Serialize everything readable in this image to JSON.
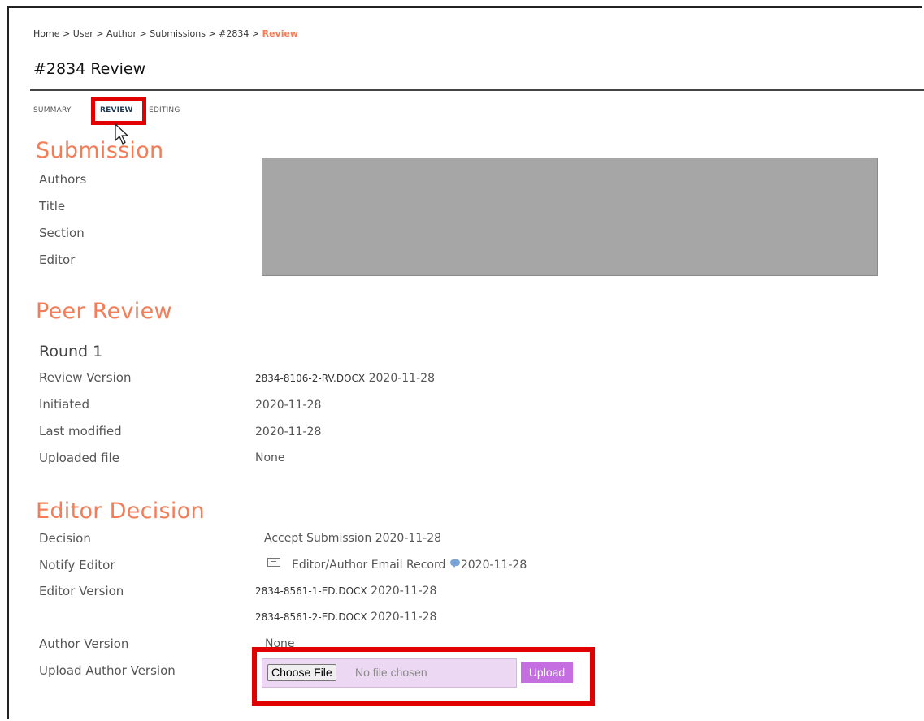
{
  "breadcrumb": {
    "items": [
      "Home",
      "User",
      "Author",
      "Submissions",
      "#2834"
    ],
    "separator": ">",
    "current": "Review"
  },
  "page": {
    "title": "#2834 Review"
  },
  "tabs": [
    {
      "label": "SUMMARY",
      "active": false
    },
    {
      "label": "REVIEW",
      "active": true
    },
    {
      "label": "EDITING",
      "active": false
    }
  ],
  "submission": {
    "heading": "Submission",
    "labels": [
      "Authors",
      "Title",
      "Section",
      "Editor"
    ]
  },
  "peer_review": {
    "heading": "Peer Review",
    "round": "Round 1",
    "rows": [
      {
        "label": "Review Version",
        "value": "2834-8106-2-RV.DOCX",
        "date": "2020-11-28"
      },
      {
        "label": "Initiated",
        "value": "2020-11-28"
      },
      {
        "label": "Last modified",
        "value": "2020-11-28"
      },
      {
        "label": "Uploaded file",
        "value": "None"
      }
    ]
  },
  "editor_decision": {
    "heading": "Editor Decision",
    "decision_label": "Decision",
    "decision_value": "Accept Submission 2020-11-28",
    "notify_label": "Notify Editor",
    "notify_link": "Editor/Author Email Record",
    "notify_date": "2020-11-28",
    "editor_version_label": "Editor Version",
    "editor_versions": [
      {
        "file": "2834-8561-1-ED.DOCX",
        "date": "2020-11-28"
      },
      {
        "file": "2834-8561-2-ED.DOCX",
        "date": "2020-11-28"
      }
    ],
    "author_version_label": "Author Version",
    "author_version_value": "None",
    "upload_label": "Upload Author Version"
  },
  "upload": {
    "choose_label": "Choose File",
    "no_file_text": "No file chosen",
    "upload_label": "Upload"
  },
  "icons": {
    "mail": "mail-icon",
    "comment": "comment-bubble-icon",
    "cursor": "mouse-pointer-icon"
  },
  "colors": {
    "accent": "#f47c57",
    "highlight": "#e10000",
    "upload_bg": "#ecd8f2",
    "upload_button": "#c46ee2",
    "redaction": "#a6a6a6"
  }
}
